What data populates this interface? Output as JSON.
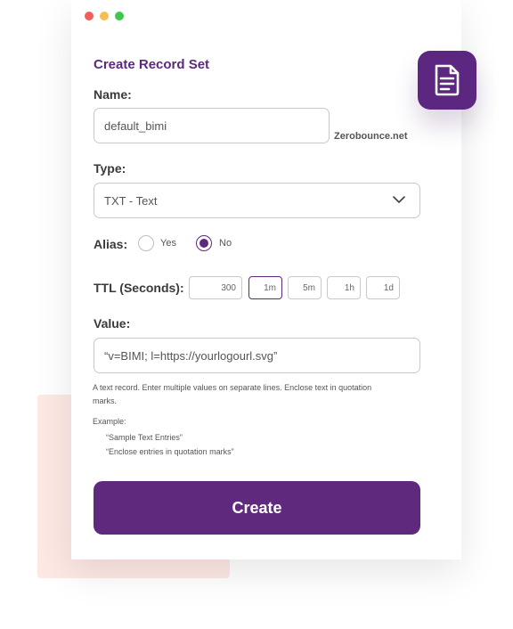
{
  "window_controls": [
    "close",
    "minimize",
    "maximize"
  ],
  "form": {
    "title": "Create Record Set",
    "name": {
      "label": "Name:",
      "value": "default_bimi",
      "suffix": "Zerobounce.net"
    },
    "type": {
      "label": "Type:",
      "selected": "TXT - Text"
    },
    "alias": {
      "label": "Alias:",
      "options": [
        {
          "label": "Yes",
          "checked": false
        },
        {
          "label": "No",
          "checked": true
        }
      ]
    },
    "ttl": {
      "label": "TTL (Seconds):",
      "value": "300",
      "presets": [
        "1m",
        "5m",
        "1h",
        "1d"
      ],
      "selected_preset": "1m"
    },
    "value": {
      "label": "Value:",
      "text": "“v=BIMI; l=https://yourlogourl.svg”"
    },
    "help_text": "A text record. Enter multiple values on separate lines. Enclose text in quotation marks.",
    "example": {
      "label": "Example:",
      "items": [
        "“Sample Text Entries”",
        "“Enclose entries in quotation marks”"
      ]
    },
    "submit_label": "Create"
  },
  "icons": {
    "badge": "document-icon",
    "dropdown": "chevron-down-icon"
  },
  "colors": {
    "brand_purple": "#5f2a7e",
    "accent_pink": "#fde8e4"
  }
}
